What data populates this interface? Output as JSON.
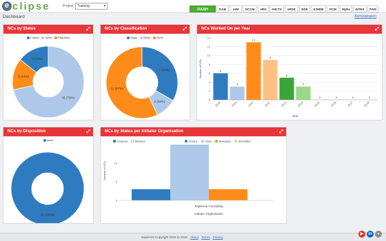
{
  "app": {
    "logo_e": "e",
    "logo_text_a": "cl",
    "logo_text_b": "ipse"
  },
  "project": {
    "label": "Project",
    "value": "Training"
  },
  "nav": {
    "tabs": [
      "DASH",
      "DAB",
      "AIM",
      "DCCM",
      "eRO",
      "eNCTS",
      "eRSK",
      "EDE",
      "ICMDB",
      "PCM",
      "MyEo",
      "INTEX",
      "PAM"
    ]
  },
  "page": {
    "title": "Dashboard",
    "admin_link": "Administration"
  },
  "colors": {
    "blue": "#2f7bbf",
    "lightblue": "#aec8ea",
    "orange": "#ff8c1a",
    "lightorange": "#ffc183",
    "green": "#3aa63a",
    "lightgreen": "#98d98a",
    "header_red": "#e8363a",
    "dash_green": "#4caf2e"
  },
  "cards": {
    "status": {
      "title": "NCs by Status"
    },
    "classification": {
      "title": "NCs by Classification"
    },
    "per_year": {
      "title": "NCs Worked On per Year"
    },
    "disposition": {
      "title": "NCs by Disposition"
    },
    "initiator": {
      "title": "NCs by Status per Initiator Organisation"
    }
  },
  "chart_data": [
    {
      "type": "pie",
      "chart": "status",
      "legend": [
        "Closed",
        "Open",
        "Released"
      ],
      "slices": [
        {
          "name": "Closed",
          "value": 3,
          "label": "3 (14%)"
        },
        {
          "name": "Open",
          "value": 15,
          "label": "15 (71%)"
        },
        {
          "name": "Released",
          "value": 3,
          "label": "3 (14%)"
        }
      ]
    },
    {
      "type": "pie",
      "chart": "classification",
      "legend": [
        "Major",
        "Minor",
        "None"
      ],
      "slices": [
        {
          "name": "Major",
          "value": 7,
          "label": "7 (33%)"
        },
        {
          "name": "Minor",
          "value": 2,
          "label": "2 (10%)"
        },
        {
          "name": "None",
          "value": 12,
          "label": "12 (57%)"
        }
      ]
    },
    {
      "type": "bar",
      "chart": "per_year",
      "categories": [
        "2009",
        "2010",
        "2011",
        "2012",
        "2013",
        "2014",
        "2015",
        "2016",
        "2017",
        "2018"
      ],
      "values": [
        6,
        3,
        13,
        9,
        5,
        3,
        0,
        0,
        0,
        0
      ],
      "ylabel": "Number of NCs",
      "xlabel": "Year",
      "ylim": [
        0,
        14
      ],
      "yticks": [
        0,
        2,
        4,
        6,
        8,
        10,
        12,
        14
      ]
    },
    {
      "type": "pie",
      "chart": "disposition",
      "legend": [
        "None"
      ],
      "slices": [
        {
          "name": "None",
          "value": 21,
          "label": "21 (100%)"
        }
      ]
    },
    {
      "type": "bar",
      "chart": "initiator",
      "legend": [
        "Grouped",
        "Stacked",
        "Closed",
        "Open",
        "Released",
        "Submitted"
      ],
      "categories": [
        "Sapienza Consulting"
      ],
      "series": [
        {
          "name": "Closed",
          "values": [
            3
          ]
        },
        {
          "name": "Open",
          "values": [
            15
          ]
        },
        {
          "name": "Released",
          "values": [
            3
          ]
        },
        {
          "name": "Submitted",
          "values": [
            0
          ]
        }
      ],
      "ylabel": "Number of NCs",
      "xlabel": "Initiator Organisation",
      "ylim": [
        0,
        15
      ],
      "yticks": [
        0,
        5,
        10
      ]
    }
  ],
  "footer": {
    "copyright": "Sapienza Copyright 2009 to 2018",
    "links": [
      "About",
      "Terms",
      "Privacy"
    ]
  },
  "social": [
    "youtube",
    "linkedin",
    "chat"
  ]
}
